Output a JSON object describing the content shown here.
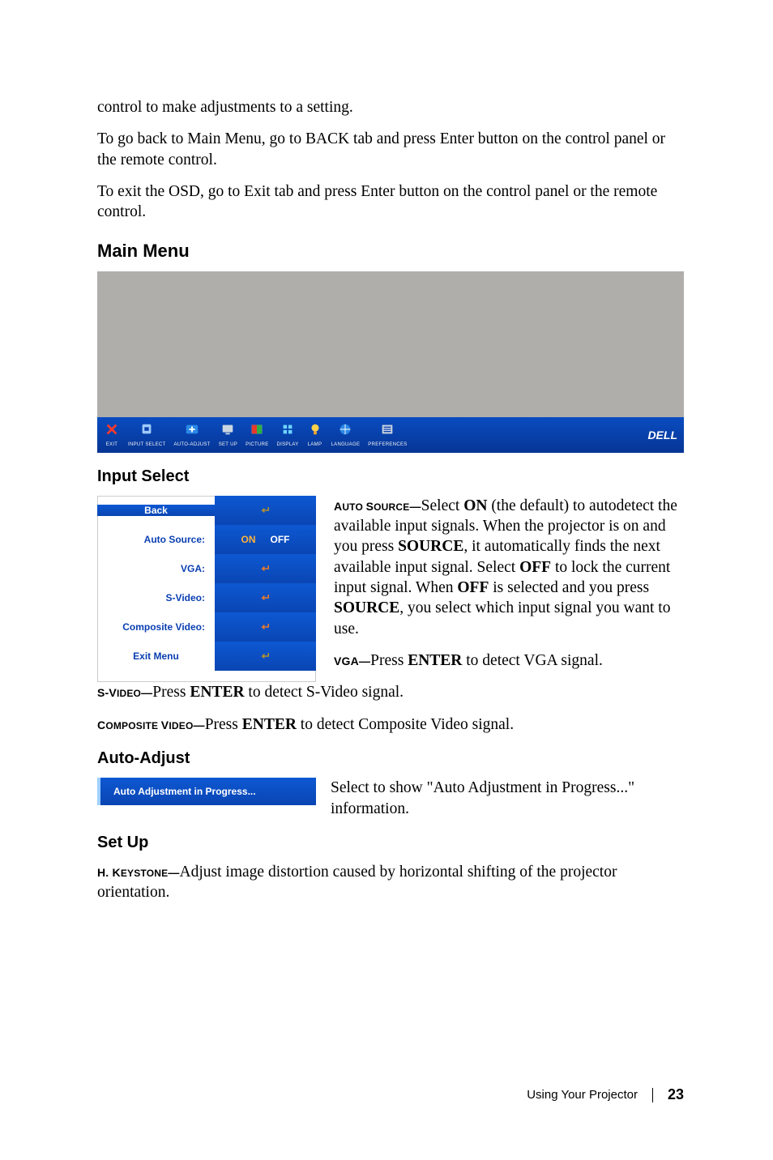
{
  "intro": {
    "p1": "control to make adjustments to a setting.",
    "p2": "To go back to Main Menu, go to BACK tab and press Enter button on the control panel or the remote control.",
    "p3": "To exit the OSD, go to Exit tab and press Enter button on the control panel or the remote control."
  },
  "headings": {
    "mainMenu": "Main Menu",
    "inputSelect": "Input Select",
    "autoAdjust": "Auto-Adjust",
    "setUp": "Set Up"
  },
  "osdTabs": [
    {
      "label": "EXIT",
      "icon": "close-icon"
    },
    {
      "label": "INPUT SELECT",
      "icon": "socket-icon"
    },
    {
      "label": "AUTO-ADJUST",
      "icon": "arrows-icon"
    },
    {
      "label": "SET UP",
      "icon": "monitor-icon"
    },
    {
      "label": "PICTURE",
      "icon": "picture-icon"
    },
    {
      "label": "DISPLAY",
      "icon": "display-icon"
    },
    {
      "label": "LAMP",
      "icon": "lamp-icon"
    },
    {
      "label": "LANGUAGE",
      "icon": "globe-icon"
    },
    {
      "label": "PREFERENCES",
      "icon": "list-icon"
    }
  ],
  "brand": "DELL",
  "inputMenu": {
    "back": "Back",
    "rows": {
      "autoSource": "Auto Source:",
      "on": "ON",
      "off": "OFF",
      "vga": "VGA:",
      "svideo": "S-Video:",
      "composite": "Composite Video:",
      "exit": "Exit Menu"
    }
  },
  "descriptions": {
    "autoSource": {
      "head1": "A",
      "head2": "UTO ",
      "head3": "S",
      "head4": "OURCE",
      "dash": "—",
      "text1": "Select ",
      "opt_on": "ON",
      "text1b": " (the default) to autodetect the available input signals. When the projector is on and you press ",
      "src1": "SOURCE",
      "text1c": ", it automatically finds the next available input signal. Select ",
      "opt_off": "OFF",
      "text1d": " to lock the current input signal. When ",
      "opt_off2": "OFF",
      "text1e": " is selected and you press ",
      "src2": "SOURCE",
      "text1f": ", you select which input signal you want to use."
    },
    "vga": {
      "head": "VGA—",
      "text": "Press ",
      "key": "ENTER",
      "text2": " to detect VGA signal."
    },
    "svideo": {
      "head1": "S-V",
      "head2": "IDEO",
      "dash": "—",
      "text": "Press ",
      "key": "ENTER",
      "text2": " to detect S-Video signal."
    },
    "composite": {
      "head1": "C",
      "head2": "OMPOSITE ",
      "head3": "V",
      "head4": "IDEO",
      "dash": "—",
      "text": "Press ",
      "key": "ENTER",
      "text2": " to detect Composite Video signal."
    },
    "autoAdjust": {
      "bar": "Auto Adjustment in Progress...",
      "text": "Select to show \"Auto Adjustment in Progress...\" information."
    },
    "hkeystone": {
      "head1": "H. K",
      "head2": "EYSTONE",
      "dash": "—",
      "text": "Adjust image distortion caused by horizontal shifting of the projector orientation."
    }
  },
  "footer": {
    "section": "Using Your Projector",
    "page": "23"
  }
}
